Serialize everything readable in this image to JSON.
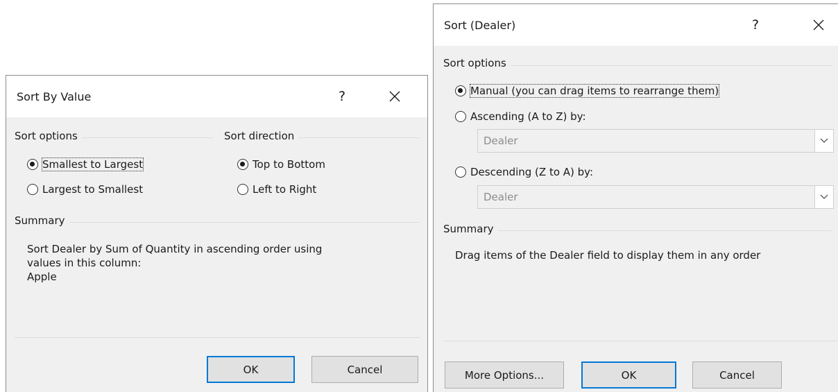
{
  "sort_by_value": {
    "title": "Sort By Value",
    "help_label": "?",
    "sort_options": {
      "label": "Sort options",
      "options": [
        {
          "label": "Smallest to Largest",
          "checked": true
        },
        {
          "label": "Largest to Smallest",
          "checked": false
        }
      ]
    },
    "sort_direction": {
      "label": "Sort direction",
      "options": [
        {
          "label": "Top to Bottom",
          "checked": true
        },
        {
          "label": "Left to Right",
          "checked": false
        }
      ]
    },
    "summary": {
      "label": "Summary",
      "line1": "Sort Dealer by Sum of Quantity in ascending order using",
      "line2": "values in this column:",
      "line3": "Apple"
    },
    "ok_label": "OK",
    "cancel_label": "Cancel"
  },
  "sort_dealer": {
    "title": "Sort (Dealer)",
    "help_label": "?",
    "sort_options": {
      "label": "Sort options",
      "manual": {
        "label": "Manual (you can drag items to rearrange them)",
        "checked": true
      },
      "ascending": {
        "label": "Ascending (A to Z) by:",
        "checked": false,
        "field_value": "Dealer"
      },
      "descending": {
        "label": "Descending (Z to A) by:",
        "checked": false,
        "field_value": "Dealer"
      }
    },
    "summary": {
      "label": "Summary",
      "text": "Drag items of the Dealer field to display them in any order"
    },
    "more_options_label": "More Options...",
    "ok_label": "OK",
    "cancel_label": "Cancel"
  },
  "colors": {
    "dialog_bg": "#f0f0f0",
    "titlebar_bg": "#ffffff",
    "default_button_border": "#0078d7"
  }
}
